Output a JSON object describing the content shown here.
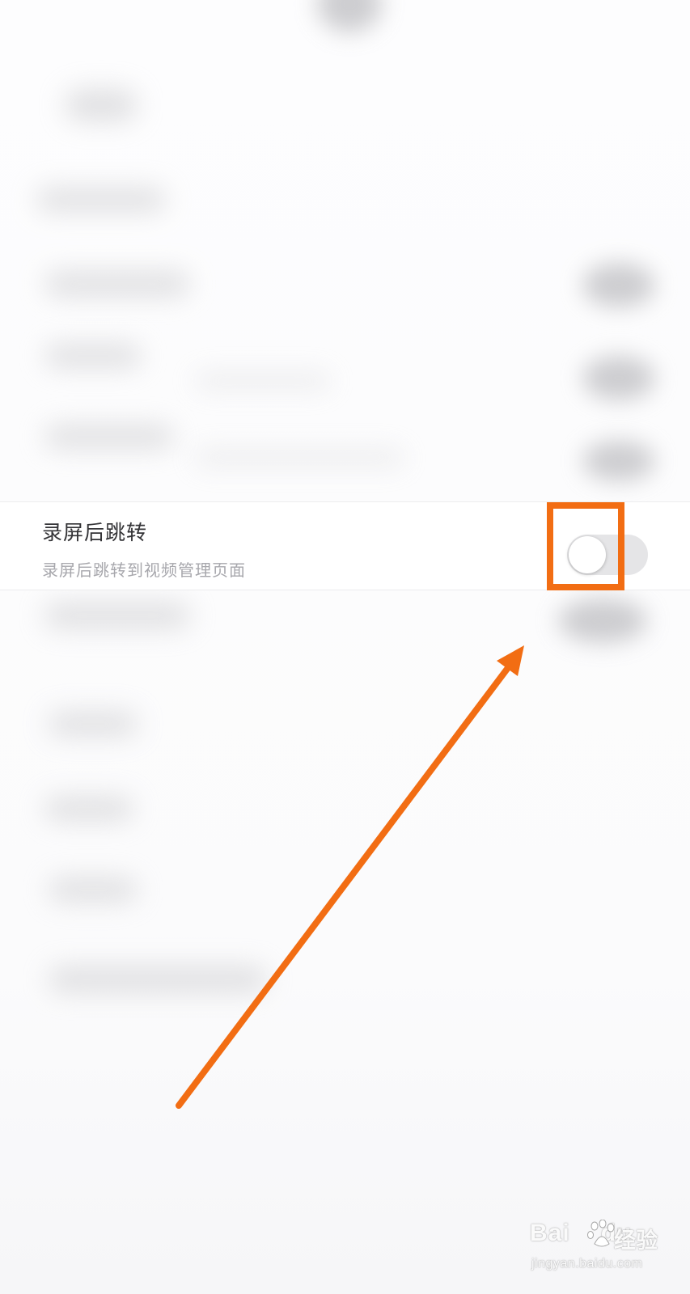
{
  "setting": {
    "title": "录屏后跳转",
    "subtitle": "录屏后跳转到视频管理页面",
    "toggle_state": "off"
  },
  "annotation": {
    "color": "#f26d13"
  },
  "watermark": {
    "brand": "Bai",
    "brand_suffix": "du",
    "product": "经验",
    "url": "jingyan.baidu.com"
  },
  "icons": [
    "baidu-paw-icon",
    "arrow-icon"
  ]
}
